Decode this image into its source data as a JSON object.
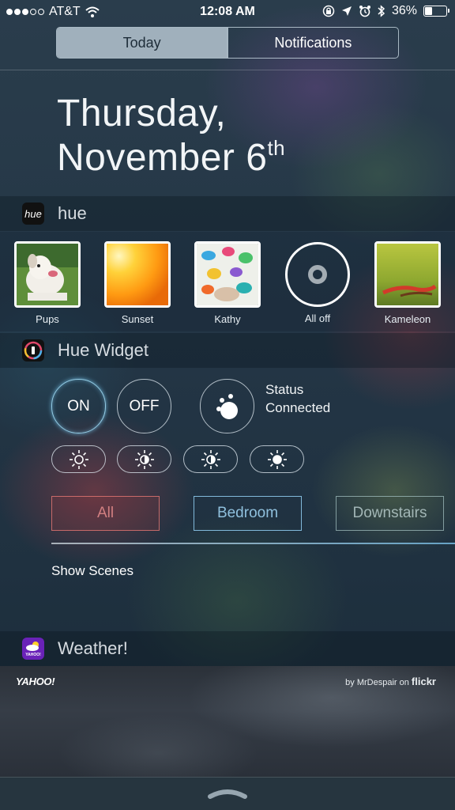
{
  "status_bar": {
    "carrier": "AT&T",
    "time": "12:08 AM",
    "battery_percent": "36%",
    "battery_level": 0.36,
    "signal_bars": 3,
    "signal_total": 5
  },
  "segmented": {
    "today": "Today",
    "notifications": "Notifications",
    "selected": "Today"
  },
  "date": {
    "weekday": "Thursday,",
    "month_day": "November 6",
    "suffix": "th"
  },
  "hue": {
    "app_icon_text": "hue",
    "title": "hue",
    "scenes": [
      {
        "label": "Pups"
      },
      {
        "label": "Sunset"
      },
      {
        "label": "Kathy"
      },
      {
        "label": "All off"
      },
      {
        "label": "Kameleon"
      }
    ]
  },
  "hue_widget": {
    "title": "Hue Widget",
    "on_label": "ON",
    "off_label": "OFF",
    "status_label": "Status",
    "status_value": "Connected",
    "groups": {
      "all": "All",
      "bedroom": "Bedroom",
      "downstairs": "Downstairs"
    },
    "show_scenes": "Show Scenes"
  },
  "weather": {
    "title": "Weather!",
    "app_icon_text": "YAHOO!",
    "yahoo": "YAHOO!",
    "credit_prefix": "by MrDespair on",
    "credit_site": "flickr"
  },
  "colors": {
    "accent_blue": "#7cc7ee",
    "all_red": "#e06a62",
    "weather_purple": "#6a22b8"
  }
}
